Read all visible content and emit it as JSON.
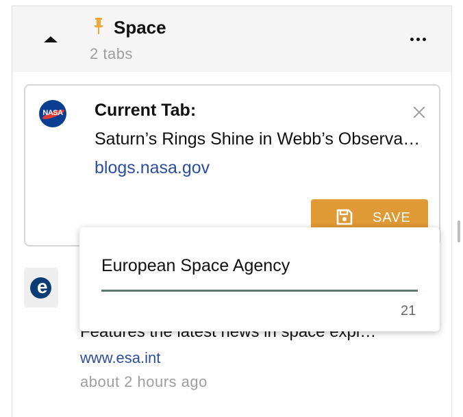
{
  "group": {
    "title": "Space",
    "tab_count": "2 tabs",
    "pin_color": "#f2a93b"
  },
  "current_tab": {
    "label": "Current Tab:",
    "title": "Saturn’s Rings Shine in Webb’s Observations of Ringed Planet",
    "url": "blogs.nasa.gov",
    "favicon_text": "NASA",
    "save_label": "SAVE",
    "save_color": "#e09a35"
  },
  "rename_popover": {
    "value": "European Space Agency",
    "char_count": "21"
  },
  "saved_tab": {
    "favicon_letter": "e",
    "description": "Features the latest news in space exploration",
    "url": "www.esa.int",
    "time": "about 2 hours ago"
  },
  "colors": {
    "link": "#2b4ea2",
    "muted": "#9e9e9e",
    "underline": "#5e7a6f"
  }
}
